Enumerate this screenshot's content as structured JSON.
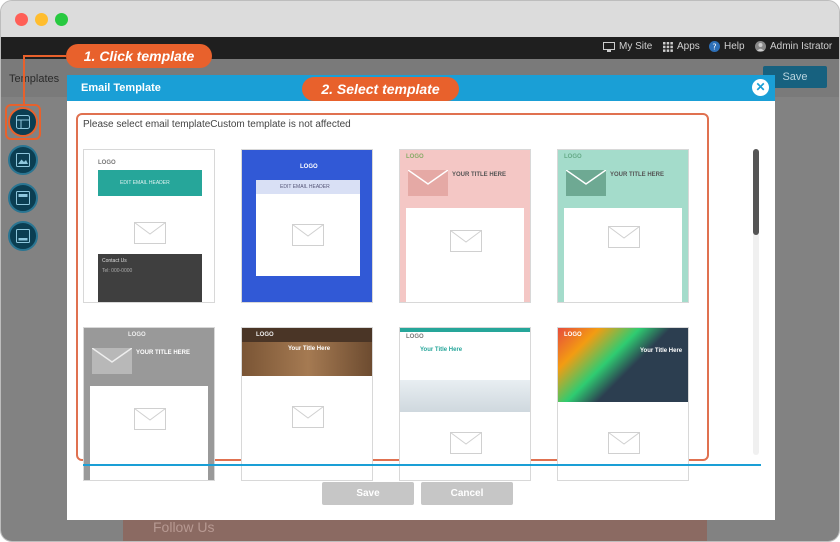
{
  "window": {
    "dots": {
      "red": "#ff5f57",
      "yellow": "#ffbd2e",
      "green": "#28c940"
    }
  },
  "top_nav": {
    "my_site": "My Site",
    "apps": "Apps",
    "help": "Help",
    "user": "Admin Istrator"
  },
  "app": {
    "templates_label": "Templates",
    "save_label": "Save",
    "follow_us": "Follow Us"
  },
  "callouts": {
    "step1": "1. Click template",
    "step2": "2. Select template"
  },
  "modal": {
    "title": "Email Template",
    "instruction": "Please select email templateCustom template is not affected",
    "save_label": "Save",
    "cancel_label": "Cancel"
  },
  "templates": [
    {
      "name": "white-teal",
      "logo": "LOGO",
      "header": "EDIT EMAIL HEADER",
      "contact": "Contact Us",
      "info": "Tel: 000-0000"
    },
    {
      "name": "blue",
      "logo": "LOGO",
      "header": "EDIT EMAIL HEADER"
    },
    {
      "name": "pink",
      "logo": "LOGO",
      "title": "YOUR TITLE HERE"
    },
    {
      "name": "mint",
      "logo": "LOGO",
      "title": "YOUR TITLE HERE"
    },
    {
      "name": "gray",
      "logo": "LOGO",
      "title": "YOUR TITLE HERE"
    },
    {
      "name": "wood",
      "logo": "LOGO",
      "title": "Your Title Here"
    },
    {
      "name": "office",
      "logo": "LOGO",
      "title": "Your Title Here"
    },
    {
      "name": "pencils",
      "logo": "LOGO",
      "title": "Your Title Here"
    }
  ],
  "colors": {
    "accent": "#1a9fd6",
    "callout": "#e8612c",
    "teal": "#26a69a",
    "blue": "#3159d6",
    "pink": "#f4c7c5",
    "mint": "#a4dccb",
    "gray": "#999999"
  }
}
